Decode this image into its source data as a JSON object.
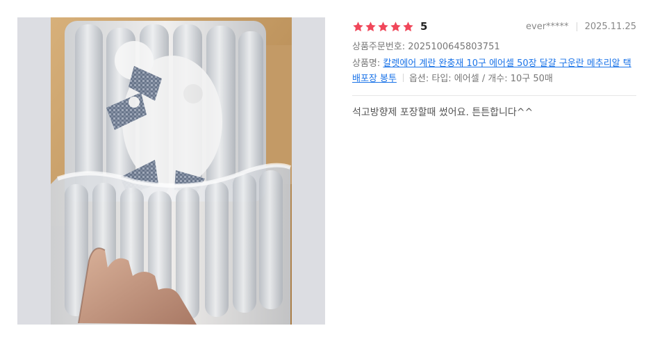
{
  "review": {
    "rating": {
      "stars": 5,
      "max_stars": 5,
      "score_label": "5",
      "star_color": "#f0475a"
    },
    "author": "ever*****",
    "date": "2025.11.25",
    "order_label": "상품주문번호:",
    "order_number": "2025100645803751",
    "product_label": "상품명:",
    "product_name": "칼렛에어 계란 완충재 10구 에어셀 50장 달걀 구운란 메추리알 택배포장 봉투",
    "option_text": "옵션: 타입: 에어셀 / 개수: 10구 50매",
    "body": "석고방향제 포장할때 썼어요. 튼튼합니다^^"
  },
  "colors": {
    "link": "#1a73e8",
    "photo_matte": "#dcdde2"
  }
}
